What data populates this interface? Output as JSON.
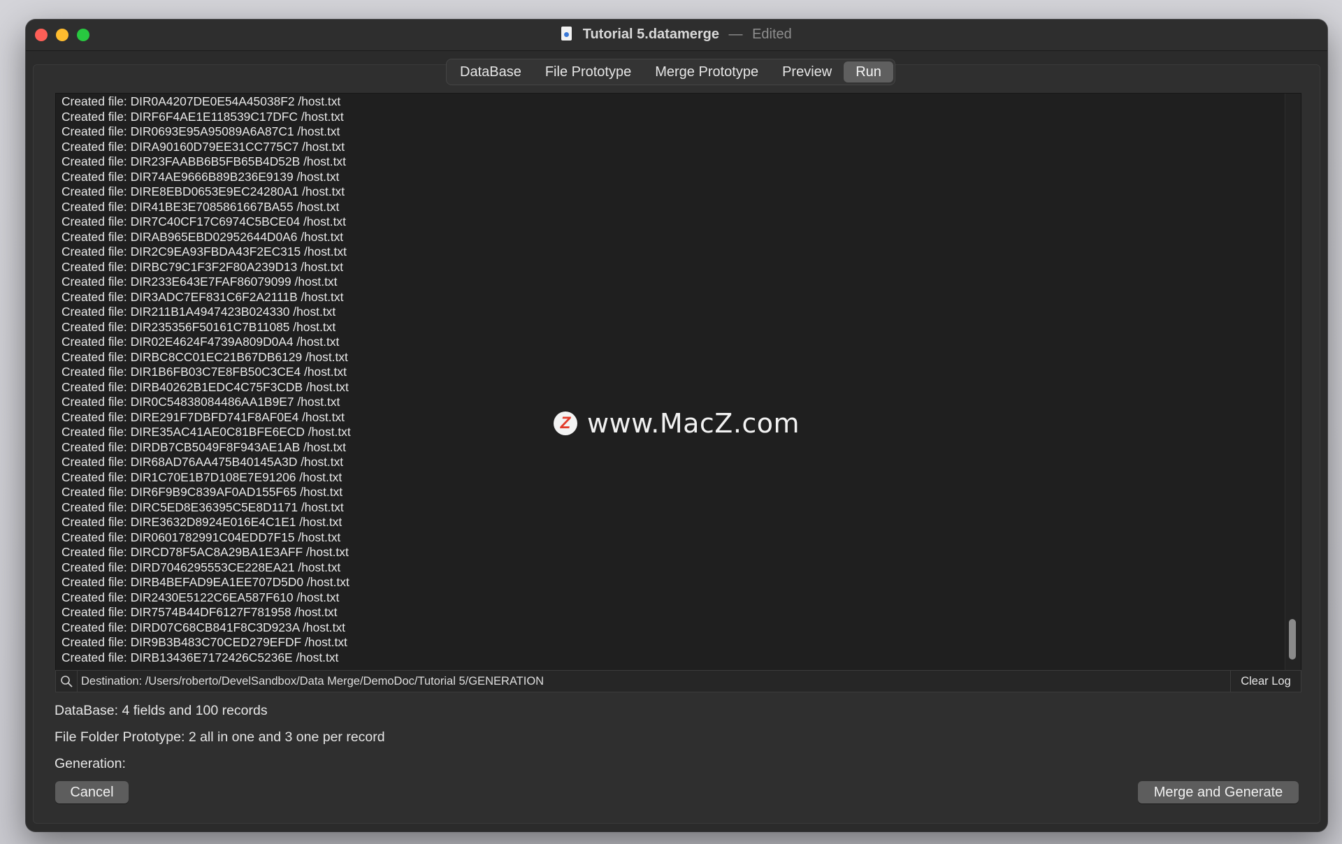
{
  "window": {
    "document_name": "Tutorial 5.datamerge",
    "separator": "—",
    "status": "Edited"
  },
  "tabs": [
    {
      "label": "DataBase",
      "active": false
    },
    {
      "label": "File Prototype",
      "active": false
    },
    {
      "label": "Merge Prototype",
      "active": false
    },
    {
      "label": "Preview",
      "active": false
    },
    {
      "label": "Run",
      "active": true
    }
  ],
  "log": {
    "lines": [
      "Created file: DIR0A4207DE0E54A45038F2 /host.txt",
      "Created file: DIRF6F4AE1E118539C17DFC /host.txt",
      "Created file: DIR0693E95A95089A6A87C1 /host.txt",
      "Created file: DIRA90160D79EE31CC775C7 /host.txt",
      "Created file: DIR23FAABB6B5FB65B4D52B /host.txt",
      "Created file: DIR74AE9666B89B236E9139 /host.txt",
      "Created file: DIRE8EBD0653E9EC24280A1 /host.txt",
      "Created file: DIR41BE3E7085861667BA55 /host.txt",
      "Created file: DIR7C40CF17C6974C5BCE04 /host.txt",
      "Created file: DIRAB965EBD02952644D0A6 /host.txt",
      "Created file: DIR2C9EA93FBDA43F2EC315 /host.txt",
      "Created file: DIRBC79C1F3F2F80A239D13 /host.txt",
      "Created file: DIR233E643E7FAF86079099 /host.txt",
      "Created file: DIR3ADC7EF831C6F2A2111B /host.txt",
      "Created file: DIR211B1A4947423B024330 /host.txt",
      "Created file: DIR235356F50161C7B11085 /host.txt",
      "Created file: DIR02E4624F4739A809D0A4 /host.txt",
      "Created file: DIRBC8CC01EC21B67DB6129 /host.txt",
      "Created file: DIR1B6FB03C7E8FB50C3CE4 /host.txt",
      "Created file: DIRB40262B1EDC4C75F3CDB /host.txt",
      "Created file: DIR0C54838084486AA1B9E7 /host.txt",
      "Created file: DIRE291F7DBFD741F8AF0E4 /host.txt",
      "Created file: DIRE35AC41AE0C81BFE6ECD /host.txt",
      "Created file: DIRDB7CB5049F8F943AE1AB /host.txt",
      "Created file: DIR68AD76AA475B40145A3D /host.txt",
      "Created file: DIR1C70E1B7D108E7E91206 /host.txt",
      "Created file: DIR6F9B9C839AF0AD155F65 /host.txt",
      "Created file: DIRC5ED8E36395C5E8D1171 /host.txt",
      "Created file: DIRE3632D8924E016E4C1E1 /host.txt",
      "Created file: DIR0601782991C04EDD7F15 /host.txt",
      "Created file: DIRCD78F5AC8A29BA1E3AFF /host.txt",
      "Created file: DIRD7046295553CE228EA21 /host.txt",
      "Created file: DIRB4BEFAD9EA1EE707D5D0 /host.txt",
      "Created file: DIR2430E5122C6EA587F610 /host.txt",
      "Created file: DIR7574B44DF6127F781958 /host.txt",
      "Created file: DIRD07C68CB841F8C3D923A /host.txt",
      "Created file: DIR9B3B483C70CED279EFDF /host.txt",
      "Created file: DIRB13436E7172426C5236E /host.txt"
    ]
  },
  "watermark": {
    "logo_letter": "Z",
    "text": "www.MacZ.com"
  },
  "destination": {
    "text": "Destination: /Users/roberto/DevelSandbox/Data Merge/DemoDoc/Tutorial 5/GENERATION",
    "search_icon": "magnifier-icon",
    "clear_label": "Clear Log"
  },
  "summary": {
    "database": "DataBase:  4 fields and 100 records",
    "file_folder": "File Folder Prototype: 2 all in one and 3 one per record",
    "generation": "Generation:"
  },
  "buttons": {
    "cancel": "Cancel",
    "merge": "Merge and Generate"
  },
  "colors": {
    "window_bg": "#2b2b2b",
    "log_bg": "#1f1f1f",
    "close": "#fe5f57",
    "minimize": "#febc2e",
    "zoom": "#28c840"
  }
}
